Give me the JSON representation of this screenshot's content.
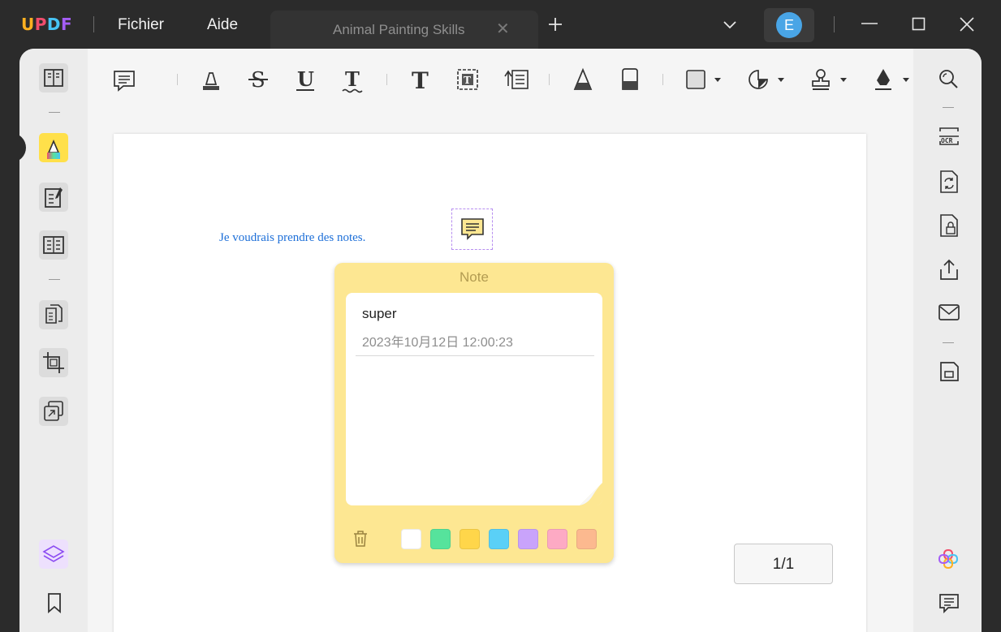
{
  "app": {
    "logo": [
      "U",
      "P",
      "D",
      "F"
    ],
    "logo_colors": [
      "#ffb020",
      "#f04d6c",
      "#47c4f5",
      "#a45df5"
    ],
    "menu": {
      "file": "Fichier",
      "help": "Aide"
    },
    "tab": {
      "title": "Animal Painting Skills",
      "close": "✕",
      "add": "+"
    },
    "user": {
      "initial": "E",
      "avatar_color": "#49a5e6"
    }
  },
  "document": {
    "text": "Je voudrais prendre des notes.",
    "text_color": "#1d6fd8"
  },
  "note": {
    "title": "Note",
    "content": "super",
    "timestamp": "2023年10月12日 12:00:23",
    "background": "#fde792",
    "colors": [
      "#ffffff",
      "#56e39c",
      "#ffd64a",
      "#5ad0f7",
      "#c9a3fb",
      "#fdaac4",
      "#fcb98f"
    ]
  },
  "pagination": {
    "label": "1/1"
  },
  "icons": {
    "left": [
      "reader-icon",
      "comment-icon",
      "edit-icon",
      "form-icon",
      "organize-icon",
      "crop-icon",
      "convert-icon",
      "layers-icon",
      "bookmark-icon"
    ],
    "toolbar": [
      "sticky-note-icon",
      "highlight-icon",
      "strikethrough-icon",
      "underline-icon",
      "squiggly-icon",
      "text-icon",
      "textbox-icon",
      "text-callout-icon",
      "pencil-icon",
      "eraser-icon",
      "shape-icon",
      "sticker-icon",
      "stamp-icon",
      "signature-icon"
    ],
    "right": [
      "search-icon",
      "ocr-icon",
      "convert-file-icon",
      "protect-icon",
      "share-icon",
      "email-icon",
      "save-icon",
      "ai-icon",
      "comments-panel-icon"
    ]
  }
}
